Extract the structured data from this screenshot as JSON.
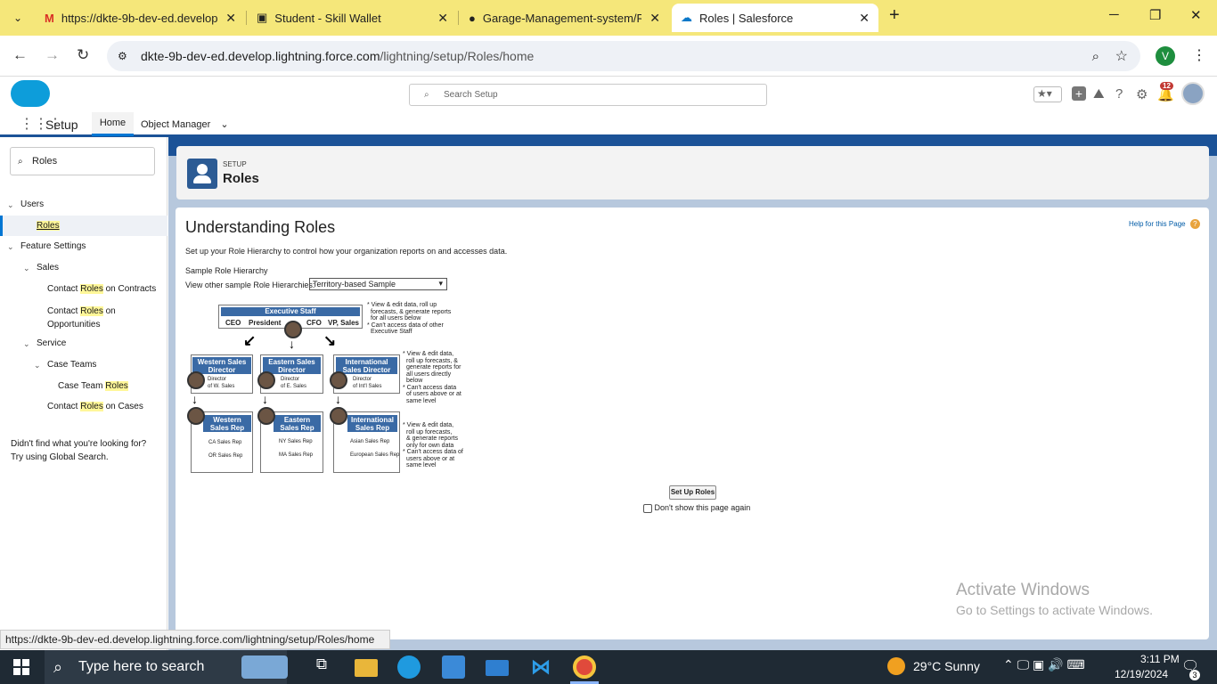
{
  "browser": {
    "tabs": [
      {
        "title": "https://dkte-9b-dev-ed.develop"
      },
      {
        "title": "Student - Skill Wallet"
      },
      {
        "title": "Garage-Management-system/R"
      },
      {
        "title": "Roles | Salesforce"
      }
    ],
    "url_host": "dkte-9b-dev-ed.develop.lightning.force.com",
    "url_path": "/lightning/setup/Roles/home",
    "profile_letter": "V"
  },
  "sf": {
    "search_placeholder": "Search Setup",
    "notif_count": "12",
    "app_name": "Setup",
    "nav_home": "Home",
    "nav_object_manager": "Object Manager"
  },
  "sidebar": {
    "quickfind_value": "Roles",
    "users": "Users",
    "roles": "Roles",
    "feature_settings": "Feature Settings",
    "sales": "Sales",
    "contact": "Contact ",
    "roles_word": "Roles",
    "on_contracts": " on Contracts",
    "on": " on",
    "opportunities": "Opportunities",
    "service": "Service",
    "case_teams": "Case Teams",
    "case_team": "Case Team ",
    "on_cases": " on Cases",
    "help1": "Didn't find what you're looking for?",
    "help2": "Try using Global Search."
  },
  "page": {
    "breadcrumb": "SETUP",
    "title": "Roles",
    "heading": "Understanding Roles",
    "help_link": "Help for this Page",
    "intro": "Set up your Role Hierarchy to control how your organization reports on and accesses data.",
    "sample_label": "Sample Role Hierarchy",
    "view_other": "View other sample Role Hierarchies:",
    "select_value": "Territory-based Sample",
    "setup_button": "Set Up Roles",
    "dont_show": "Don't show this page again"
  },
  "diagram": {
    "exec": "Executive Staff",
    "ceo": "CEO",
    "president": "President",
    "cfo": "CFO",
    "vp": "VP, Sales",
    "note1": [
      "* View & edit data, roll up",
      "forecasts, & generate reports",
      "for all users below",
      "* Can't access data of other",
      "Executive Staff"
    ],
    "west_dir": [
      "Western Sales",
      "Director"
    ],
    "west_dir_sub": [
      "Director",
      "of W. Sales"
    ],
    "east_dir": [
      "Eastern Sales",
      "Director"
    ],
    "east_dir_sub": [
      "Director",
      "of E. Sales"
    ],
    "intl_dir": [
      "International",
      "Sales Director"
    ],
    "intl_dir_sub": [
      "Director",
      "of Int'l Sales"
    ],
    "note2": [
      "* View & edit data,",
      "roll up forecasts, &",
      "generate reports for",
      "all users directly",
      "below",
      "* Can't access data",
      "of users above or at",
      "same level"
    ],
    "west_rep": [
      "Western",
      "Sales Rep"
    ],
    "west_rep_sub": [
      "CA Sales Rep",
      "OR Sales Rep"
    ],
    "east_rep": [
      "Eastern",
      "Sales Rep"
    ],
    "east_rep_sub": [
      "NY Sales Rep",
      "MA Sales Rep"
    ],
    "intl_rep": [
      "International",
      "Sales Rep"
    ],
    "intl_rep_sub": [
      "Asian Sales Rep",
      "European Sales Rep"
    ],
    "note3": [
      "* View & edit data,",
      "roll up forecasts,",
      "& generate reports",
      "only for own data",
      "* Can't access data of",
      "users above or at",
      "same level"
    ]
  },
  "watermark": {
    "line1": "Activate Windows",
    "line2": "Go to Settings to activate Windows."
  },
  "statusbar": "https://dkte-9b-dev-ed.develop.lightning.force.com/lightning/setup/Roles/home",
  "taskbar": {
    "search": "Type here to search",
    "weather": "29°C  Sunny",
    "time": "3:11 PM",
    "date": "12/19/2024",
    "notif": "3"
  }
}
